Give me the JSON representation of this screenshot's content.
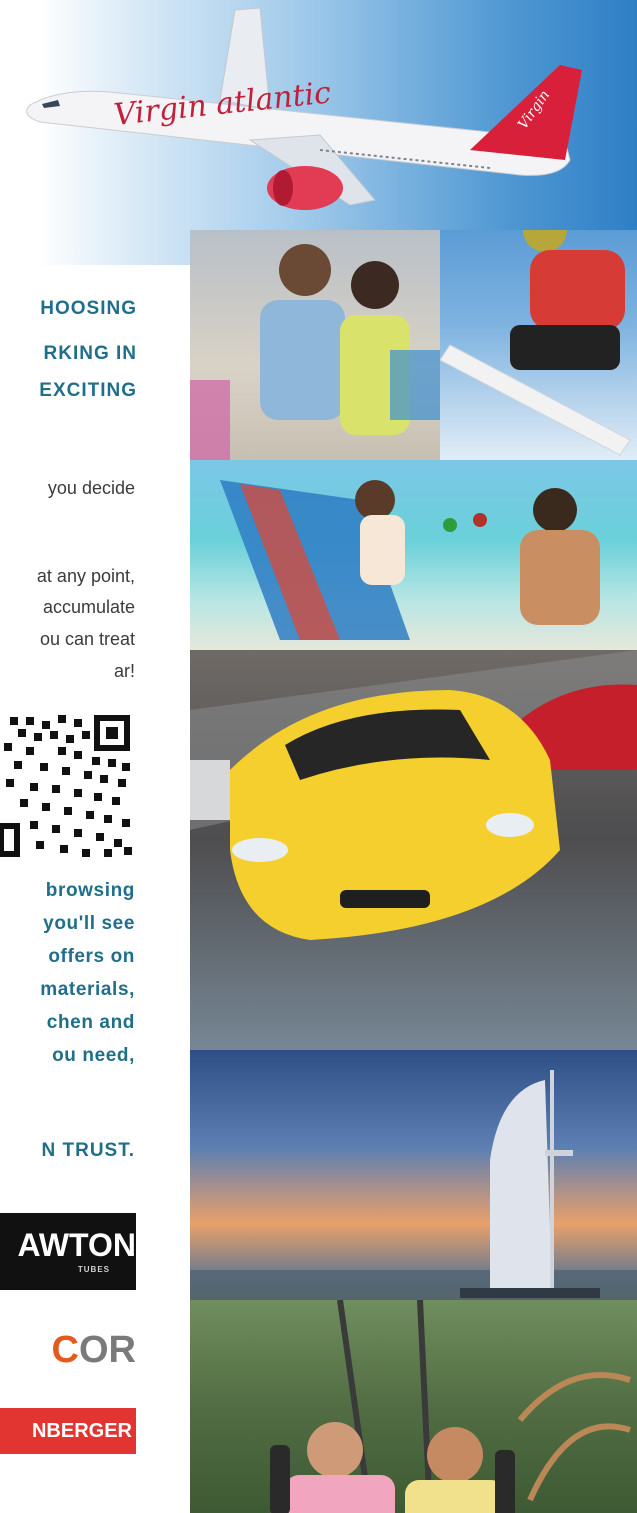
{
  "banner": {
    "airline_logo_text": "Virgin atlantic",
    "tail_logo_text": "Virgin"
  },
  "headline": {
    "line1": "HOOSING",
    "line2": "RKING IN",
    "line3": "EXCITING"
  },
  "body": {
    "line1": "you decide",
    "line2": "at any point,",
    "line3": "accumulate",
    "line4": "ou can treat",
    "line5": "ar!"
  },
  "callout": {
    "line1": "browsing",
    "line2": "you'll see",
    "line3": "offers on",
    "line4": "materials,",
    "line5": "chen and",
    "line6": "ou need,"
  },
  "trust_line": "N TRUST.",
  "logos": {
    "logo1": "AWTON",
    "logo1_sub": "TUBES",
    "logo2_c": "C",
    "logo2_rest": "OR",
    "logo3": "NBERGER"
  },
  "colors": {
    "heading_blue": "#1f6f8b",
    "body_text": "#3b3b3b",
    "red_logo": "#e23431",
    "virgin_red": "#d8203a"
  }
}
